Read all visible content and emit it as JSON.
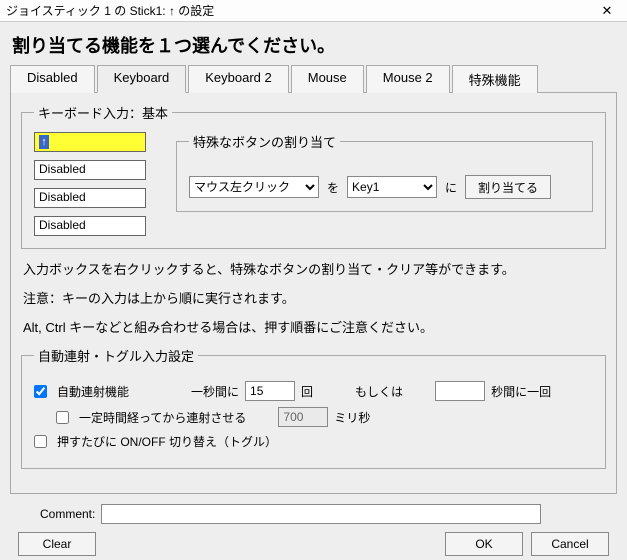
{
  "window": {
    "title": "ジョイスティック 1 の Stick1: ↑ の設定"
  },
  "instruction": "割り当てる機能を１つ選んでください。",
  "tabs": {
    "t0": "Disabled",
    "t1": "Keyboard",
    "t2": "Keyboard 2",
    "t3": "Mouse",
    "t4": "Mouse 2",
    "t5": "特殊機能"
  },
  "kb_group": {
    "legend": "キーボード入力：基本",
    "box1_glyph": "↑",
    "box2": "Disabled",
    "box3": "Disabled",
    "box4": "Disabled"
  },
  "special": {
    "legend": "特殊なボタンの割り当て",
    "click_sel": "マウス左クリック",
    "wo": "を",
    "key_sel": "Key1",
    "ni": "に",
    "assign_btn": "割り当てる"
  },
  "notes": {
    "n1": "入力ボックスを右クリックすると、特殊なボタンの割り当て・クリア等ができます。",
    "n2": "注意：キーの入力は上から順に実行されます。",
    "n3": "Alt, Ctrl キーなどと組み合わせる場合は、押す順番にご注意ください。"
  },
  "autofire": {
    "legend": "自動連射・トグル入力設定",
    "cb_auto": "自動連射機能",
    "persec_pre": "一秒間に",
    "persec_val": "15",
    "persec_post": "回",
    "or_label": "もしくは",
    "sec_per_label": "秒間に一回",
    "cb_delay": "一定時間経ってから連射させる",
    "delay_val": "700",
    "delay_unit": "ミリ秒",
    "cb_toggle": "押すたびに ON/OFF 切り替え（トグル）"
  },
  "comment": {
    "label": "Comment:",
    "value": ""
  },
  "buttons": {
    "clear": "Clear",
    "ok": "OK",
    "cancel": "Cancel"
  }
}
